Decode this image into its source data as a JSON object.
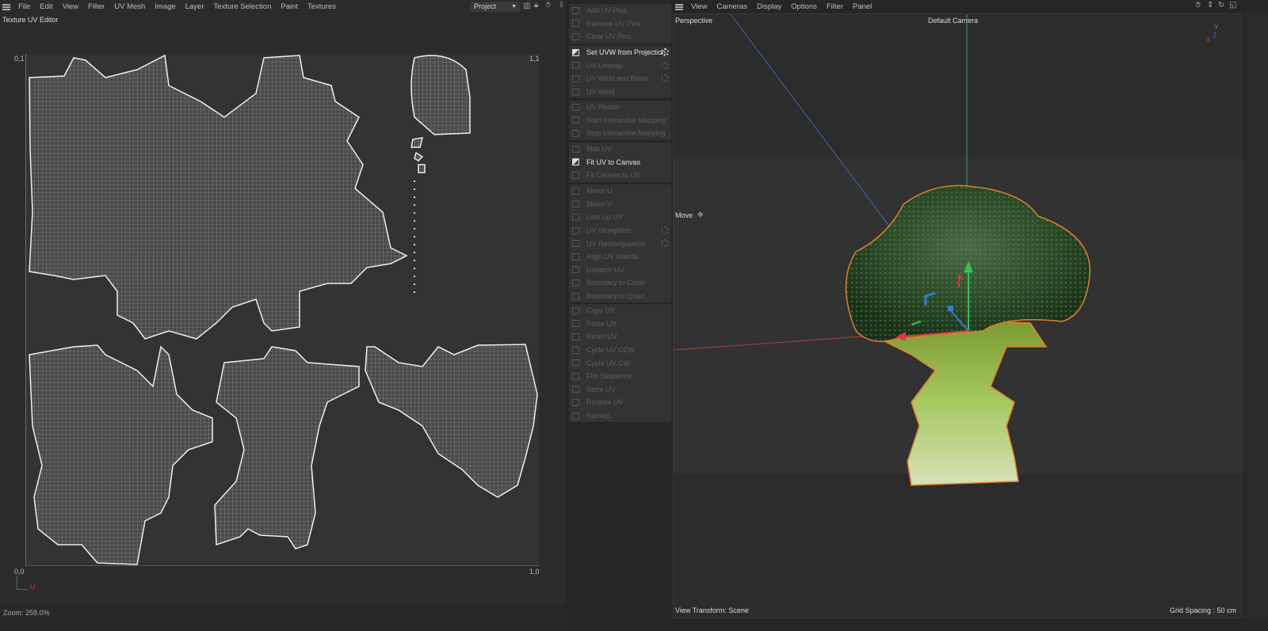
{
  "left_menu": [
    "File",
    "Edit",
    "View",
    "Filter",
    "UV Mesh",
    "Image",
    "Layer",
    "Texture Selection",
    "Paint",
    "Textures"
  ],
  "panel_title": "Texture UV Editor",
  "project_dropdown": "Project",
  "uv_labels": {
    "top_left": "0,1",
    "top_right": "1,1",
    "bottom_left": "0,0",
    "bottom_right": "1,0",
    "axis_u": "U"
  },
  "zoom_status": "Zoom: 259.0%",
  "tool_groups": [
    [
      {
        "label": "Add UV Pins",
        "enabled": false
      },
      {
        "label": "Remove UV Pins",
        "enabled": false
      },
      {
        "label": "Clear UV Pins",
        "enabled": false
      }
    ],
    [
      {
        "label": "Set UVW from Projection",
        "enabled": true,
        "gear": true
      },
      {
        "label": "UV Unwrap",
        "enabled": false,
        "gear": true
      },
      {
        "label": "UV Weld and Relax",
        "enabled": false,
        "gear": true
      },
      {
        "label": "UV Weld",
        "enabled": false
      }
    ],
    [
      {
        "label": "UV Peeler",
        "enabled": false
      },
      {
        "label": "Start Interactive Mapping",
        "enabled": false
      },
      {
        "label": "Stop Interactive Mapping",
        "enabled": false
      }
    ],
    [
      {
        "label": "Max UV",
        "enabled": false
      },
      {
        "label": "Fit UV to Canvas",
        "enabled": true
      },
      {
        "label": "Fit Canvas to UV",
        "enabled": false
      }
    ],
    [
      {
        "label": "Mirror U",
        "enabled": false
      },
      {
        "label": "Mirror V",
        "enabled": false
      },
      {
        "label": "Line Up UV",
        "enabled": false
      },
      {
        "label": "UV Straighten",
        "enabled": false,
        "gear": true
      },
      {
        "label": "UV Rectangularize",
        "enabled": false,
        "gear": true
      },
      {
        "label": "Align UV Islands",
        "enabled": false
      },
      {
        "label": "Unstitch UV",
        "enabled": false
      },
      {
        "label": "Boundary to Circle",
        "enabled": false
      },
      {
        "label": "Boundary to Quad",
        "enabled": false
      }
    ],
    [
      {
        "label": "Copy UV",
        "enabled": false
      },
      {
        "label": "Paste UV",
        "enabled": false
      },
      {
        "label": "Reset UV",
        "enabled": false
      },
      {
        "label": "Cycle UV CCW",
        "enabled": false
      },
      {
        "label": "Cycle UV CW",
        "enabled": false
      },
      {
        "label": "Flip Sequence",
        "enabled": false
      },
      {
        "label": "Store UV",
        "enabled": false
      },
      {
        "label": "Restore UV",
        "enabled": false
      },
      {
        "label": "Remap...",
        "enabled": false
      }
    ]
  ],
  "viewport_menu": [
    "View",
    "Cameras",
    "Display",
    "Options",
    "Filter",
    "Panel"
  ],
  "viewport": {
    "projection": "Perspective",
    "camera": "Default Camera",
    "tool": "Move",
    "view_transform": "View Transform: Scene",
    "grid_spacing": "Grid Spacing : 50 cm",
    "axes": {
      "x": "X",
      "y": "Y",
      "z": "Z"
    }
  },
  "colors": {
    "selection_outline": "#e0802c",
    "axis_x": "#d04040",
    "axis_y": "#40c060",
    "axis_z": "#4070d0"
  }
}
